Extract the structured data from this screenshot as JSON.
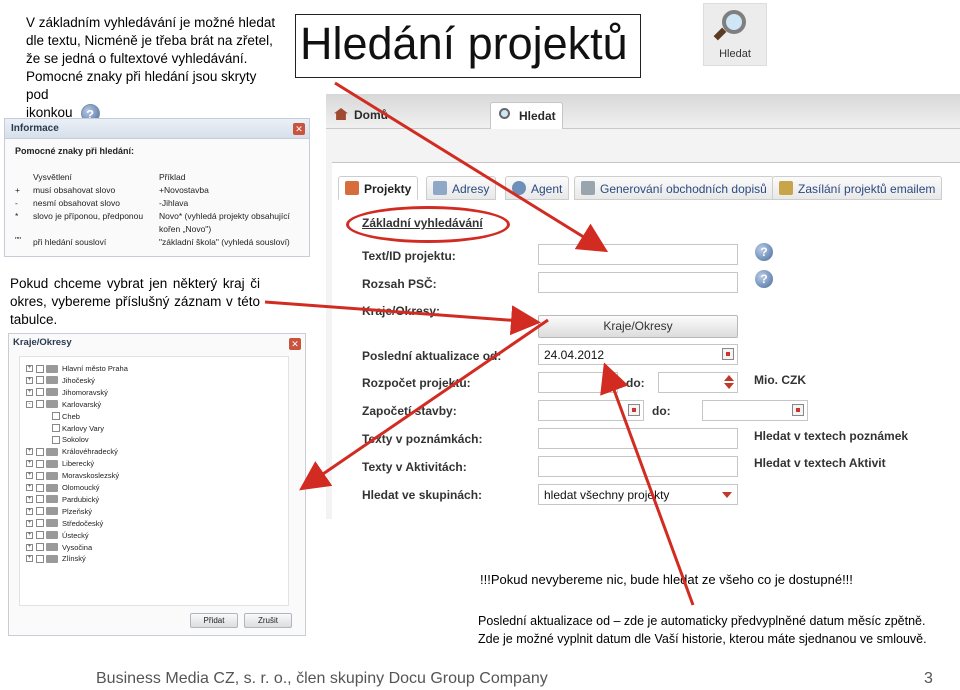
{
  "intro": {
    "line1": "V základním vyhledávání je možné hledat",
    "line2": "dle textu, Nicméně je třeba brát na zřetel,",
    "line3": "že se jedná o fultextové vyhledávání.",
    "line4": "Pomocné znaky při hledání jsou skryty pod",
    "line5": "ikonkou"
  },
  "title": "Hledání projektů",
  "hledat_button": "Hledat",
  "info_panel": {
    "title": "Informace",
    "subtitle": "Pomocné znaky při hledání:",
    "col_symbol_header": "",
    "col_explain_header": "Vysvětlení",
    "col_example_header": "Příklad",
    "rows": [
      {
        "symbol": "+",
        "explain": "musí obsahovat slovo",
        "example": "+Novostavba"
      },
      {
        "symbol": "-",
        "explain": "nesmí obsahovat slovo",
        "example": "-Jihlava"
      },
      {
        "symbol": "*",
        "explain": "slovo je příponou, předponou",
        "example": "Novo* (vyhledá projekty obsahující"
      },
      {
        "symbol": "",
        "explain": "",
        "example": "kořen „Novo\")"
      },
      {
        "symbol": "\"\"",
        "explain": "při hledání sousloví",
        "example": "\"základní škola\" (vyhledá sousloví)"
      }
    ]
  },
  "kraj_text": "Pokud chceme vybrat jen některý kraj či okres, vybereme příslušný záznam v této tabulce.",
  "tree_panel": {
    "title": "Kraje/Okresy",
    "items": [
      {
        "label": "Hlavní město Praha",
        "indent": 0,
        "pm": "+"
      },
      {
        "label": "Jihočeský",
        "indent": 0,
        "pm": "+"
      },
      {
        "label": "Jihomoravský",
        "indent": 0,
        "pm": "+"
      },
      {
        "label": "Karlovarský",
        "indent": 0,
        "pm": "-"
      },
      {
        "label": "Cheb",
        "indent": 1,
        "pm": ""
      },
      {
        "label": "Karlovy Vary",
        "indent": 1,
        "pm": ""
      },
      {
        "label": "Sokolov",
        "indent": 1,
        "pm": ""
      },
      {
        "label": "Královéhradecký",
        "indent": 0,
        "pm": "+"
      },
      {
        "label": "Liberecký",
        "indent": 0,
        "pm": "+"
      },
      {
        "label": "Moravskoslezský",
        "indent": 0,
        "pm": "+"
      },
      {
        "label": "Olomoucký",
        "indent": 0,
        "pm": "+"
      },
      {
        "label": "Pardubický",
        "indent": 0,
        "pm": "+"
      },
      {
        "label": "Plzeňský",
        "indent": 0,
        "pm": "+"
      },
      {
        "label": "Středočeský",
        "indent": 0,
        "pm": "+"
      },
      {
        "label": "Ústecký",
        "indent": 0,
        "pm": "+"
      },
      {
        "label": "Vysočina",
        "indent": 0,
        "pm": "+"
      },
      {
        "label": "Zlínský",
        "indent": 0,
        "pm": "+"
      }
    ],
    "add_button": "Přidat",
    "cancel_button": "Zrušit"
  },
  "app": {
    "top_tabs": [
      "Domů",
      "Hledat"
    ],
    "sub_tabs": [
      "Projekty",
      "Adresy",
      "Agent",
      "Generování obchodních dopisů",
      "Zasílání projektů emailem"
    ],
    "section_title": "Základní vyhledávání",
    "labels": {
      "text_id": "Text/ID projektu:",
      "psc": "Rozsah PSČ:",
      "kraje": "Kraje/Okresy:",
      "last_update": "Poslední aktualizace od:",
      "budget": "Rozpočet projektu:",
      "start": "Započetí stavby:",
      "notes": "Texty v poznámkách:",
      "activities": "Texty v Aktivitách:",
      "groups": "Hledat ve skupinách:",
      "to": "do:",
      "to2": "do:"
    },
    "kraje_button": "Kraje/Okresy",
    "last_update_value": "24.04.2012",
    "groups_value": "hledat všechny projekty",
    "mio_czk": "Mio. CZK",
    "search_notes": "Hledat v textech poznámek",
    "search_activities": "Hledat v textech Aktivit"
  },
  "no_select_note": "!!!Pokud nevybereme nic, bude hledat ze všeho co je dostupné!!!",
  "auto_note": {
    "line1": "Poslední aktualizace od – zde je automaticky předvyplněné datum měsíc zpětně.",
    "line2": "Zde je možné vyplnit datum dle Vaší historie, kterou máte sjednanou ve smlouvě."
  },
  "footer": "Business Media CZ, s. r. o., člen skupiny Docu Group Company",
  "page_number": "3",
  "colors": {
    "arrow": "#d22b22",
    "accent": "#2a4a80"
  }
}
